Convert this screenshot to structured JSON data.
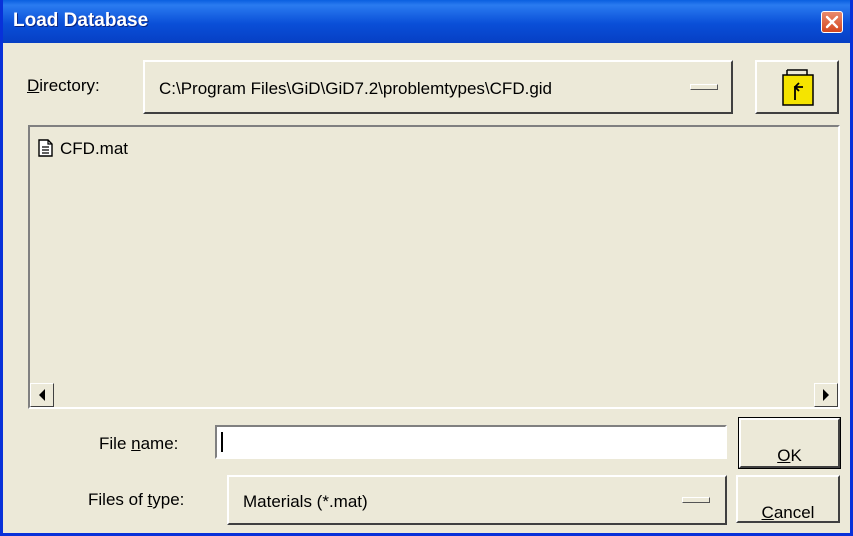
{
  "window": {
    "title": "Load Database"
  },
  "directory": {
    "label_pre": "",
    "label_hot": "D",
    "label_post": "irectory:",
    "value": "C:\\Program Files\\GiD\\GiD7.2\\problemtypes\\CFD.gid",
    "up_button_icon": "up-folder-icon"
  },
  "file_list": {
    "items": [
      {
        "name": "CFD.mat",
        "icon": "document-icon"
      }
    ]
  },
  "file_name": {
    "label_pre": "File ",
    "label_hot": "n",
    "label_post": "ame:",
    "value": ""
  },
  "file_type": {
    "label_pre": "Files of ",
    "label_hot": "t",
    "label_post": "ype:",
    "value": "Materials (*.mat)"
  },
  "buttons": {
    "ok_hot": "O",
    "ok_post": "K",
    "cancel_hot": "C",
    "cancel_post": "ancel"
  },
  "colors": {
    "title_bar": "#0a4fd8",
    "dialog_bg": "#ece9d8",
    "close_button": "#d4461e",
    "folder_icon": "#f5e400"
  }
}
